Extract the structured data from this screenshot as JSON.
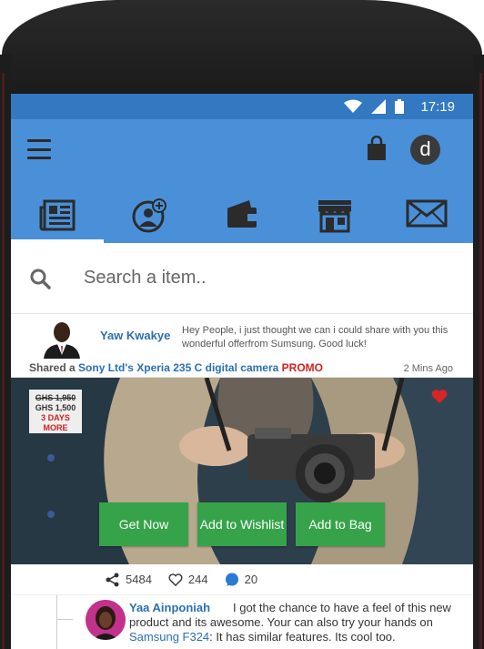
{
  "status_bar": {
    "time": "17:19"
  },
  "header": {
    "menu_icon": "hamburger-icon",
    "bag_icon": "shopping-bag-icon",
    "avatar_letter": "d",
    "tabs": [
      {
        "icon": "newspaper-icon",
        "active": true
      },
      {
        "icon": "add-user-icon",
        "active": false
      },
      {
        "icon": "wallet-icon",
        "active": false
      },
      {
        "icon": "store-icon",
        "active": false
      },
      {
        "icon": "mail-icon",
        "active": false
      }
    ],
    "colors": {
      "status_bar": "#3279c2",
      "header": "#4a90d9"
    }
  },
  "search": {
    "placeholder": "Search a item.."
  },
  "post": {
    "user": "Yaw Kwakye",
    "text": "Hey People, i just thought we can i could share with you this wonderful offerfrom Sumsung. Good luck!",
    "shared_prefix": "Shared a",
    "shared_link": "Sony Ltd's Xperia 235 C digital camera",
    "promo": "PROMO",
    "time": "2 Mins Ago",
    "price_old": "GHS 1,950",
    "price_new": "GHS 1,500",
    "days": "3 DAYS",
    "days_more": "MORE",
    "buttons": {
      "get_now": "Get Now",
      "wishlist": "Add to Wishlist",
      "bag": "Add to Bag"
    },
    "stats": {
      "shares": "5484",
      "likes": "244",
      "comments": "20"
    }
  },
  "comment": {
    "user": "Yaa Ainponiah",
    "text_before": "I got the chance to have a feel of this new product  and its awesome. Your can also try your hands on",
    "link": "Samsung F324",
    "text_after": ": It has similar features. Its cool too."
  }
}
